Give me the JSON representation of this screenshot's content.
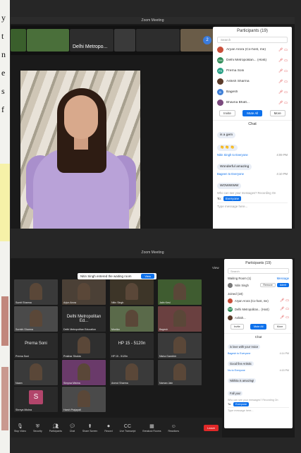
{
  "page": {
    "side_text": [
      "y",
      "t",
      "n",
      "e",
      "s",
      "f"
    ]
  },
  "meeting1": {
    "window_title": "Zoom Meeting",
    "strip_tiles": [
      {
        "label": "",
        "color": "#3a5f2c"
      },
      {
        "label": "",
        "color": "#4a6f3a"
      },
      {
        "label": "Delhi Metropo...",
        "color": "#2d2d2d"
      },
      {
        "label": "",
        "color": "#3a3a3a"
      },
      {
        "label": "",
        "color": "#2d2d2d"
      },
      {
        "label": "",
        "color": "#6a5c48"
      }
    ],
    "page_badge": "2",
    "participants_panel": {
      "title": "Participants (19)",
      "search_placeholder": "Search",
      "rows": [
        {
          "initials": "",
          "name": "Aryan Arora (Co-host, me)",
          "color": "#c94f3a"
        },
        {
          "initials": "DM",
          "name": "Delhi Metropolitan... (Host)",
          "color": "#2e8b57"
        },
        {
          "initials": "PS",
          "name": "Prerna Soni",
          "color": "#2aa187"
        },
        {
          "initials": "",
          "name": "Ashish Sharma",
          "color": "#5b3b2a"
        },
        {
          "initials": "B",
          "name": "Bagesh",
          "color": "#3f7fd6"
        },
        {
          "initials": "",
          "name": "Bhavna Bhatt...",
          "color": "#7b4a7e"
        }
      ],
      "buttons": {
        "invite": "Invite",
        "mute_all": "Mute All",
        "more": "More"
      }
    },
    "chat": {
      "title": "Chat",
      "messages": [
        {
          "type": "bubble",
          "text": "is a gem"
        },
        {
          "type": "bubble",
          "text": "👏 👏 👏"
        },
        {
          "type": "meta",
          "from": "Nitin Singh to Everyone",
          "time": "4:09 PM"
        },
        {
          "type": "bubble",
          "text": "Wonderful amazing"
        },
        {
          "type": "meta",
          "from": "Bageen to Everyone",
          "time": "4:10 PM"
        },
        {
          "type": "bubble",
          "text": "WOWWWW"
        }
      ],
      "note": "Who can see your messages? Recording On",
      "to_label": "To:",
      "to_target": "Everyone",
      "input_placeholder": "Type message here..."
    }
  },
  "meeting2": {
    "window_title": "Zoom Meeting",
    "waiting_notice": "Nitin Singh entered the waiting room",
    "view_button": "View",
    "view_label": "View",
    "tiles": [
      {
        "label": "Sumit Sharma",
        "text": "",
        "photo": true,
        "color": "#3a3a3a"
      },
      {
        "label": "Arjun Arora",
        "text": "",
        "photo": true,
        "color": "#4b4036"
      },
      {
        "label": "Nitin Singh",
        "text": "",
        "photo": true,
        "color": "#3d3528"
      },
      {
        "label": "Jatin Kesi",
        "text": "",
        "photo": true,
        "color": "#3f5c30"
      },
      {
        "label": "Surekh Sharma",
        "text": "",
        "photo": true,
        "color": "#4a4a4a"
      },
      {
        "label": "Delhi Metropolitan Education",
        "text": "Delhi Metropolitan Ed...",
        "photo": false,
        "color": "#2a2a2a"
      },
      {
        "label": "Monika",
        "text": "",
        "photo": true,
        "color": "#5a6a4a"
      },
      {
        "label": "Bagesh",
        "text": "",
        "photo": true,
        "color": "#6a4040"
      },
      {
        "label": "Prerna Soni",
        "text": "Prerna Soni",
        "photo": false,
        "color": "#2a2a2a"
      },
      {
        "label": "Prakhar Shukla",
        "text": "",
        "photo": true,
        "color": "#2f2f2f"
      },
      {
        "label": "HP 15 - 5120n",
        "text": "HP 15 - 5120n",
        "photo": false,
        "color": "#2a2a2a"
      },
      {
        "label": "Nisha Gambhir",
        "text": "",
        "photo": true,
        "color": "#3a3a3a"
      },
      {
        "label": "Naam",
        "text": "",
        "photo": true,
        "color": "#3a3a3a"
      },
      {
        "label": "Simpsa Mishra",
        "text": "",
        "photo": true,
        "color": "#6a3a6a"
      },
      {
        "label": "Anmol Sharma",
        "text": "",
        "photo": true,
        "color": "#3a3a3a"
      },
      {
        "label": "Naman Jain",
        "text": "",
        "photo": true,
        "color": "#3a3a3a"
      },
      {
        "label": "Shreya Mishra",
        "text": "",
        "square": "S",
        "color": "#2a2a2a"
      },
      {
        "label": "Harsh Prajapati",
        "text": "",
        "photo": true,
        "color": "#4a4a4a"
      }
    ],
    "toolbar": [
      {
        "icon": "mic",
        "label": "Stop Video"
      },
      {
        "icon": "shield",
        "label": "Security"
      },
      {
        "icon": "people",
        "label": "Participants"
      },
      {
        "icon": "chat",
        "label": "Chat"
      },
      {
        "icon": "share",
        "label": "Share Screen"
      },
      {
        "icon": "record",
        "label": "Record"
      },
      {
        "icon": "cc",
        "label": "Live Transcript"
      },
      {
        "icon": "rooms",
        "label": "Breakout Rooms"
      },
      {
        "icon": "react",
        "label": "Reactions"
      }
    ],
    "leave_label": "Leave",
    "panel": {
      "title": "Participants (19)",
      "search_placeholder": "Search",
      "waiting_title": "Waiting Room (1)",
      "waiting_action": "Message",
      "waiting_person": "Nitin Singh",
      "remove_label": "Remove",
      "admit_label": "Admit",
      "joined_title": "Joined (18)",
      "rows": [
        {
          "initials": "",
          "name": "Aryan Arora (Co-host, me)",
          "color": "#c94f3a"
        },
        {
          "initials": "DM",
          "name": "Delhi Metropolitan... (Host)",
          "color": "#2e8b57"
        },
        {
          "initials": "",
          "name": "Ashish...",
          "color": "#5b3b2a"
        }
      ],
      "buttons": {
        "invite": "Invite",
        "mute_all": "Mute All",
        "more": "More"
      },
      "chat_title": "Chat",
      "messages": [
        {
          "type": "bubble",
          "text": "is love with your Voice"
        },
        {
          "type": "meta",
          "from": "Bagesh to Everyone",
          "time": "4:14 PM"
        },
        {
          "type": "bubble",
          "text": "Good fine Artistic"
        },
        {
          "type": "meta",
          "from": "Nu to Everyone",
          "time": "4:15 PM"
        },
        {
          "type": "bubble",
          "text": "Nikhita is amazing!"
        },
        {
          "type": "bubble",
          "text": "Fall you!"
        }
      ],
      "note": "Who can see your messages? Recording On",
      "to_label": "To:",
      "to_target": "Everyone",
      "input_placeholder": "Type message here..."
    }
  }
}
